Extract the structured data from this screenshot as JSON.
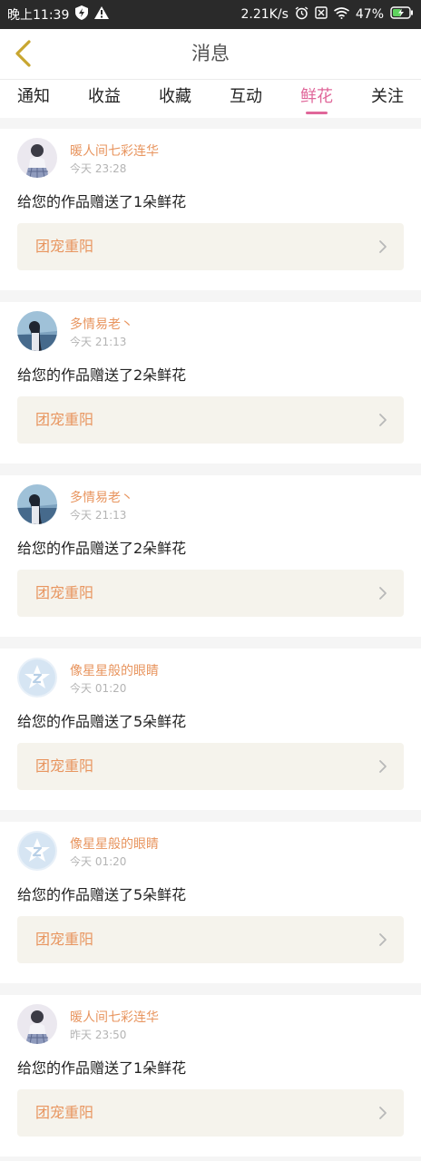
{
  "status_bar": {
    "time": "晚上11:39",
    "net_speed": "2.21K/s",
    "battery": "47%",
    "icons": [
      "shield-bolt-icon",
      "warning-icon",
      "alarm-icon",
      "sim-icon",
      "wifi-icon",
      "battery-icon"
    ]
  },
  "nav": {
    "title": "消息",
    "back_icon": "chevron-left-icon"
  },
  "tabs": [
    {
      "label": "通知",
      "active": false
    },
    {
      "label": "收益",
      "active": false
    },
    {
      "label": "收藏",
      "active": false
    },
    {
      "label": "互动",
      "active": false
    },
    {
      "label": "鲜花",
      "active": true
    },
    {
      "label": "关注",
      "active": false
    }
  ],
  "messages": [
    {
      "user": "暖人间七彩连华",
      "time": "今天 23:28",
      "text": "给您的作品赠送了1朵鲜花",
      "work": "团宠重阳",
      "avatar": "girl-avatar"
    },
    {
      "user": "多情易老丶",
      "time": "今天 21:13",
      "text": "给您的作品赠送了2朵鲜花",
      "work": "团宠重阳",
      "avatar": "sea-girl-avatar"
    },
    {
      "user": "多情易老丶",
      "time": "今天 21:13",
      "text": "给您的作品赠送了2朵鲜花",
      "work": "团宠重阳",
      "avatar": "sea-girl-avatar"
    },
    {
      "user": "像星星般的眼睛",
      "time": "今天 01:20",
      "text": "给您的作品赠送了5朵鲜花",
      "work": "团宠重阳",
      "avatar": "default-avatar"
    },
    {
      "user": "像星星般的眼睛",
      "time": "今天 01:20",
      "text": "给您的作品赠送了5朵鲜花",
      "work": "团宠重阳",
      "avatar": "default-avatar"
    },
    {
      "user": "暖人间七彩连华",
      "time": "昨天 23:50",
      "text": "给您的作品赠送了1朵鲜花",
      "work": "团宠重阳",
      "avatar": "girl-avatar"
    }
  ],
  "colors": {
    "accent_pink": "#e0679a",
    "username_orange": "#e8955f",
    "back_arrow": "#c8a630",
    "work_box_bg": "#f5f3ec"
  }
}
